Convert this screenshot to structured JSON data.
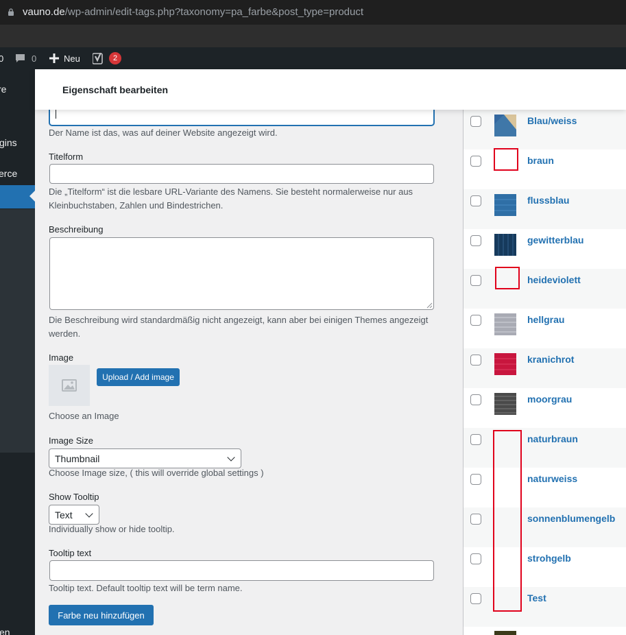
{
  "browser": {
    "url_host": "vauno.de",
    "url_path": "/wp-admin/edit-tags.php?taxonomy=pa_farbe&post_type=product"
  },
  "adminbar": {
    "leading_fragment": "0",
    "comments_count": "0",
    "new_label": "Neu",
    "yoast_badge": "2"
  },
  "adminmenu": {
    "items": [
      {
        "label": "re"
      },
      {
        "label": "gins"
      },
      {
        "label": "erce"
      },
      {
        "label": "en"
      }
    ]
  },
  "header": {
    "title": "Eigenschaft bearbeiten"
  },
  "form": {
    "name_desc": "Der Name ist das, was auf deiner Website angezeigt wird.",
    "slug_label": "Titelform",
    "slug_desc": "Die „Titelform“ ist die lesbare URL-Variante des Namens. Sie besteht normalerweise nur aus Kleinbuchstaben, Zahlen und Bindestrichen.",
    "description_label": "Beschreibung",
    "description_desc": "Die Beschreibung wird standardmäßig nicht angezeigt, kann aber bei einigen Themes angezeigt werden.",
    "image_label": "Image",
    "upload_button": "Upload / Add image",
    "image_desc": "Choose an Image",
    "image_size_label": "Image Size",
    "image_size_value": "Thumbnail",
    "image_size_desc": "Choose Image size, ( this will override global settings )",
    "tooltip_label": "Show Tooltip",
    "tooltip_value": "Text",
    "tooltip_desc": "Individually show or hide tooltip.",
    "tooltip_text_label": "Tooltip text",
    "tooltip_text_desc": "Tooltip text. Default tooltip text will be term name.",
    "submit_button": "Farbe neu hinzufügen"
  },
  "terms": [
    {
      "name": "Blau/weiss",
      "swatch": "blue-beige"
    },
    {
      "name": "braun",
      "swatch": "empty-red-outline"
    },
    {
      "name": "flussblau",
      "swatch": "blue"
    },
    {
      "name": "gewitterblau",
      "swatch": "dark-blue"
    },
    {
      "name": "heideviolett",
      "swatch": "empty-red-outline"
    },
    {
      "name": "hellgrau",
      "swatch": "light-gray"
    },
    {
      "name": "kranichrot",
      "swatch": "red"
    },
    {
      "name": "moorgrau",
      "swatch": "dark-gray"
    },
    {
      "name": "naturbraun",
      "swatch": "none"
    },
    {
      "name": "naturweiss",
      "swatch": "none"
    },
    {
      "name": "sonnenblumengelb",
      "swatch": "none"
    },
    {
      "name": "strohgelb",
      "swatch": "none"
    },
    {
      "name": "Test",
      "swatch": "none"
    }
  ],
  "colors": {
    "accent": "#2271b1",
    "admin_dark": "#1d2327",
    "highlight_red": "#e0001b",
    "badge_red": "#d63638"
  }
}
